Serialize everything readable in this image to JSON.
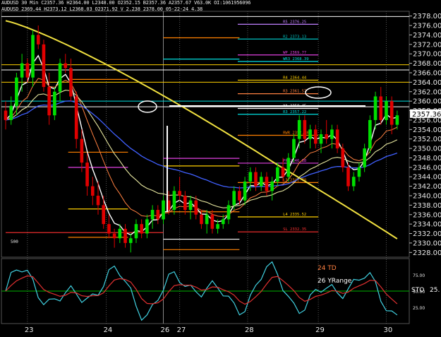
{
  "header": {
    "line1": "AUDUSD 30 Min  C2357.36  H2364.00  L2348.00  O2352.15  B2357.36  A2357.67  V63.0K  OI:1061956096",
    "line2": "AUDUSD 2369.44  H2373.12  L2368.03  O2371.92  V 2.238  2378.00  05-22-24 4.38"
  },
  "indicator_labels": {
    "td": "24 TD",
    "yrange": "26 YRange",
    "sto": "STO"
  },
  "colors": {
    "background": "#000000",
    "up_candle": "#00e000",
    "down_candle": "#e00000",
    "price_box": "#ffffff"
  },
  "chart_data": [
    {
      "type": "line",
      "panel": "price",
      "title": "",
      "ylim": [
        2327,
        2379
      ],
      "y_ticks": [
        2328,
        2330,
        2332,
        2334,
        2336,
        2338,
        2340,
        2342,
        2344,
        2346,
        2348,
        2350,
        2352,
        2354,
        2356,
        2358,
        2360,
        2362,
        2364,
        2366,
        2368,
        2370,
        2372,
        2374,
        2376,
        2378
      ],
      "y_tick_labels": [
        "2328.00",
        "2330.00",
        "2332.00",
        "2334.00",
        "2336.00",
        "2338.00",
        "2340.00",
        "2342.00",
        "2344.00",
        "2346.00",
        "2348.00",
        "2350.00",
        "2352.00",
        "2354.00",
        "2356.00",
        "2358.00",
        "2360.00",
        "2362.00",
        "2364.00",
        "2366.00",
        "2368.00",
        "2370.00",
        "2372.00",
        "2374.00",
        "2376.00",
        "2378.00"
      ],
      "x_tick_labels": [
        "23",
        "24",
        "26",
        "27",
        "28",
        "29",
        "30"
      ],
      "x_tick_index": [
        8,
        37,
        58,
        64,
        89,
        115,
        140
      ],
      "last_price": "2357.36",
      "pivot_levels": [
        {
          "label": "R5 2376.25",
          "value": 2376.25,
          "color": "#c080ff"
        },
        {
          "label": "R2 2373.13",
          "value": 2373.13,
          "color": "#00c0c0"
        },
        {
          "label": "WP 2369.77",
          "value": 2369.77,
          "color": "#e040e0"
        },
        {
          "label": "WR3 2368.39",
          "value": 2368.39,
          "color": "#00e0e0"
        },
        {
          "label": "R4 2364.44",
          "value": 2364.44,
          "color": "#ffd000"
        },
        {
          "label": "R3 2361.57",
          "value": 2361.57,
          "color": "#ff8040"
        },
        {
          "label": "YA 2358.45",
          "value": 2358.45,
          "color": "#ffffff"
        },
        {
          "label": "R3 2357.22",
          "value": 2357.22,
          "color": "#00e0e0"
        },
        {
          "label": "RWR 2352.78",
          "value": 2352.78,
          "color": "#ff8000"
        },
        {
          "label": "PP 2346.88",
          "value": 2346.88,
          "color": "#e040e0"
        },
        {
          "label": "L3 2342.78",
          "value": 2342.78,
          "color": "#ff8000"
        },
        {
          "label": "L4 2335.52",
          "value": 2335.52,
          "color": "#ffd000"
        },
        {
          "label": "SL 2332.35",
          "value": 2332.35,
          "color": "#ff3030"
        }
      ],
      "static_levels": [
        {
          "value": 2377.9,
          "color": "#ffffff"
        },
        {
          "value": 2367.7,
          "color": "#ffd000"
        },
        {
          "value": 2366.6,
          "color": "#ffffff"
        },
        {
          "value": 2364.0,
          "color": "#ffd000"
        },
        {
          "value": 2360.0,
          "color": "#00e0e0"
        },
        {
          "value": 2358.8,
          "color": "#ffffff"
        }
      ],
      "left_label": "500",
      "candles": [
        {
          "o": 2358,
          "h": 2360,
          "l": 2354,
          "c": 2356
        },
        {
          "o": 2356,
          "h": 2361,
          "l": 2355,
          "c": 2359
        },
        {
          "o": 2359,
          "h": 2366,
          "l": 2357,
          "c": 2365
        },
        {
          "o": 2365,
          "h": 2370,
          "l": 2362,
          "c": 2368
        },
        {
          "o": 2368,
          "h": 2369,
          "l": 2364,
          "c": 2365
        },
        {
          "o": 2365,
          "h": 2375,
          "l": 2363,
          "c": 2374
        },
        {
          "o": 2374,
          "h": 2376,
          "l": 2371,
          "c": 2372
        },
        {
          "o": 2372,
          "h": 2373,
          "l": 2362,
          "c": 2363
        },
        {
          "o": 2363,
          "h": 2366,
          "l": 2355,
          "c": 2357
        },
        {
          "o": 2357,
          "h": 2363,
          "l": 2356,
          "c": 2362
        },
        {
          "o": 2362,
          "h": 2369,
          "l": 2360,
          "c": 2368
        },
        {
          "o": 2368,
          "h": 2370,
          "l": 2366,
          "c": 2367
        },
        {
          "o": 2367,
          "h": 2369,
          "l": 2360,
          "c": 2361
        },
        {
          "o": 2361,
          "h": 2362,
          "l": 2350,
          "c": 2352
        },
        {
          "o": 2352,
          "h": 2354,
          "l": 2345,
          "c": 2347
        },
        {
          "o": 2347,
          "h": 2349,
          "l": 2340,
          "c": 2342
        },
        {
          "o": 2342,
          "h": 2344,
          "l": 2338,
          "c": 2340
        },
        {
          "o": 2340,
          "h": 2343,
          "l": 2336,
          "c": 2338
        },
        {
          "o": 2338,
          "h": 2340,
          "l": 2333,
          "c": 2334
        },
        {
          "o": 2334,
          "h": 2336,
          "l": 2331,
          "c": 2332
        },
        {
          "o": 2332,
          "h": 2333,
          "l": 2329,
          "c": 2331
        },
        {
          "o": 2331,
          "h": 2334,
          "l": 2330,
          "c": 2333
        },
        {
          "o": 2333,
          "h": 2334,
          "l": 2329,
          "c": 2330
        },
        {
          "o": 2330,
          "h": 2332,
          "l": 2328,
          "c": 2331
        },
        {
          "o": 2331,
          "h": 2335,
          "l": 2330,
          "c": 2334
        },
        {
          "o": 2334,
          "h": 2335,
          "l": 2331,
          "c": 2332
        },
        {
          "o": 2332,
          "h": 2336,
          "l": 2331,
          "c": 2335
        },
        {
          "o": 2335,
          "h": 2338,
          "l": 2333,
          "c": 2337
        },
        {
          "o": 2337,
          "h": 2338,
          "l": 2334,
          "c": 2335
        },
        {
          "o": 2335,
          "h": 2340,
          "l": 2334,
          "c": 2339
        },
        {
          "o": 2339,
          "h": 2341,
          "l": 2336,
          "c": 2337
        },
        {
          "o": 2337,
          "h": 2342,
          "l": 2336,
          "c": 2341
        },
        {
          "o": 2341,
          "h": 2344,
          "l": 2339,
          "c": 2340
        },
        {
          "o": 2340,
          "h": 2341,
          "l": 2336,
          "c": 2337
        },
        {
          "o": 2337,
          "h": 2340,
          "l": 2335,
          "c": 2339
        },
        {
          "o": 2339,
          "h": 2340,
          "l": 2335,
          "c": 2336
        },
        {
          "o": 2336,
          "h": 2337,
          "l": 2333,
          "c": 2334
        },
        {
          "o": 2334,
          "h": 2337,
          "l": 2332,
          "c": 2336
        },
        {
          "o": 2336,
          "h": 2337,
          "l": 2332,
          "c": 2333
        },
        {
          "o": 2333,
          "h": 2335,
          "l": 2332,
          "c": 2334
        },
        {
          "o": 2334,
          "h": 2336,
          "l": 2333,
          "c": 2335
        },
        {
          "o": 2335,
          "h": 2339,
          "l": 2334,
          "c": 2338
        },
        {
          "o": 2338,
          "h": 2342,
          "l": 2337,
          "c": 2341
        },
        {
          "o": 2341,
          "h": 2342,
          "l": 2338,
          "c": 2339
        },
        {
          "o": 2339,
          "h": 2344,
          "l": 2338,
          "c": 2343
        },
        {
          "o": 2343,
          "h": 2346,
          "l": 2341,
          "c": 2345
        },
        {
          "o": 2345,
          "h": 2346,
          "l": 2341,
          "c": 2342
        },
        {
          "o": 2342,
          "h": 2345,
          "l": 2341,
          "c": 2344
        },
        {
          "o": 2344,
          "h": 2345,
          "l": 2340,
          "c": 2341
        },
        {
          "o": 2341,
          "h": 2344,
          "l": 2339,
          "c": 2343
        },
        {
          "o": 2343,
          "h": 2347,
          "l": 2342,
          "c": 2346
        },
        {
          "o": 2346,
          "h": 2348,
          "l": 2343,
          "c": 2344
        },
        {
          "o": 2344,
          "h": 2349,
          "l": 2343,
          "c": 2348
        },
        {
          "o": 2348,
          "h": 2353,
          "l": 2347,
          "c": 2352
        },
        {
          "o": 2352,
          "h": 2357,
          "l": 2350,
          "c": 2356
        },
        {
          "o": 2356,
          "h": 2357,
          "l": 2351,
          "c": 2352
        },
        {
          "o": 2352,
          "h": 2355,
          "l": 2350,
          "c": 2354
        },
        {
          "o": 2354,
          "h": 2355,
          "l": 2350,
          "c": 2351
        },
        {
          "o": 2351,
          "h": 2354,
          "l": 2349,
          "c": 2353
        },
        {
          "o": 2353,
          "h": 2356,
          "l": 2351,
          "c": 2352
        },
        {
          "o": 2352,
          "h": 2355,
          "l": 2350,
          "c": 2354
        },
        {
          "o": 2354,
          "h": 2355,
          "l": 2349,
          "c": 2350
        },
        {
          "o": 2350,
          "h": 2351,
          "l": 2345,
          "c": 2346
        },
        {
          "o": 2346,
          "h": 2347,
          "l": 2341,
          "c": 2342
        },
        {
          "o": 2342,
          "h": 2345,
          "l": 2341,
          "c": 2344
        },
        {
          "o": 2344,
          "h": 2347,
          "l": 2343,
          "c": 2346
        },
        {
          "o": 2346,
          "h": 2351,
          "l": 2345,
          "c": 2350
        },
        {
          "o": 2350,
          "h": 2357,
          "l": 2349,
          "c": 2356
        },
        {
          "o": 2356,
          "h": 2362,
          "l": 2354,
          "c": 2361
        },
        {
          "o": 2361,
          "h": 2363,
          "l": 2355,
          "c": 2356
        },
        {
          "o": 2356,
          "h": 2361,
          "l": 2355,
          "c": 2360
        },
        {
          "o": 2360,
          "h": 2361,
          "l": 2353,
          "c": 2355
        },
        {
          "o": 2355,
          "h": 2358,
          "l": 2354,
          "c": 2357
        }
      ]
    },
    {
      "type": "line",
      "panel": "indicator",
      "title": "",
      "ylim": [
        0,
        100
      ],
      "y_tick_labels": [
        "75.00",
        "50.00",
        "25.00"
      ],
      "sto_value": "25."
    }
  ]
}
